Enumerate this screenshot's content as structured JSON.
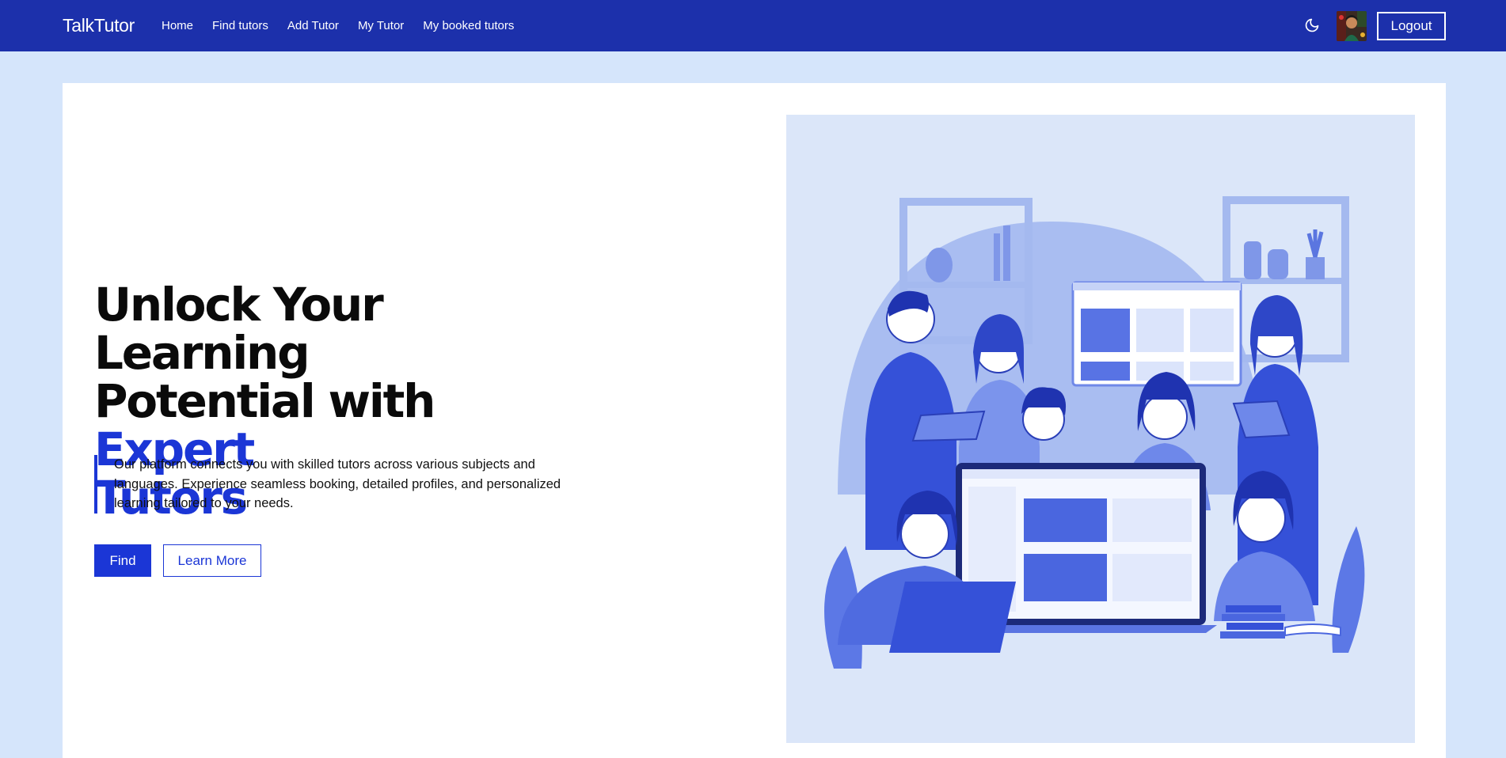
{
  "nav": {
    "brand": "TalkTutor",
    "links": [
      "Home",
      "Find tutors",
      "Add Tutor",
      "My Tutor",
      "My booked tutors"
    ],
    "logout_label": "Logout"
  },
  "hero": {
    "title_line1": "Unlock Your Learning",
    "title_line2_plain": "Potential with ",
    "title_accent_1": "Expert",
    "title_accent_2": "Tutors",
    "description": "Our platform connects you with skilled tutors across various subjects and languages. Experience seamless booking, detailed profiles, and personalized learning tailored to your needs.",
    "find_label": "Find",
    "learn_more_label": "Learn More"
  },
  "colors": {
    "nav_bg": "#1c30ab",
    "accent": "#1b36d6",
    "page_bg": "#d5e5fb"
  },
  "icons": {
    "theme_toggle": "moon-icon"
  }
}
